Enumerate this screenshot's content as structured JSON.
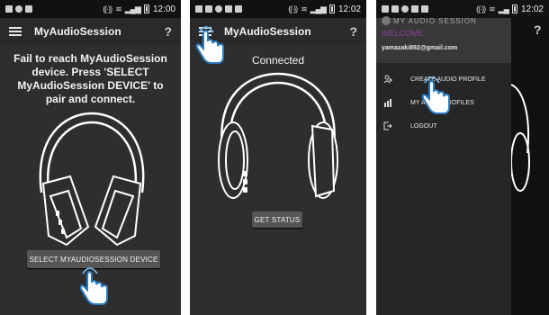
{
  "status_bar": {
    "screen1_time": "12:00",
    "screen2_time": "12:02",
    "screen3_time": "12:02"
  },
  "screen1": {
    "app_title": "MyAudioSession",
    "help_label": "?",
    "message": "Fail to reach MyAudioSession device. Press 'SELECT MyAudioSession DEVICE' to pair and connect.",
    "button_label": "SELECT MYAUDIOSESSION DEVICE"
  },
  "screen2": {
    "app_title": "MyAudioSession",
    "help_label": "?",
    "status_text": "Connected",
    "button_label": "GET STATUS"
  },
  "screen3": {
    "logo_text": "MY AUDIO SESSION",
    "welcome": "WELCOME",
    "email": "yamazaki892@gmail.com",
    "help_label": "?",
    "menu": [
      {
        "label": "CREATE AUDIO PROFILE",
        "icon": "add-profile-icon"
      },
      {
        "label": "MY AUDIO PROFILES",
        "icon": "bars-icon"
      },
      {
        "label": "LOGOUT",
        "icon": "logout-icon"
      }
    ]
  },
  "colors": {
    "screen_bg": "#2e2e2e",
    "appbar_bg": "#2a2a2a",
    "button_bg": "#555555",
    "welcome_accent": "#8e3fa0"
  }
}
